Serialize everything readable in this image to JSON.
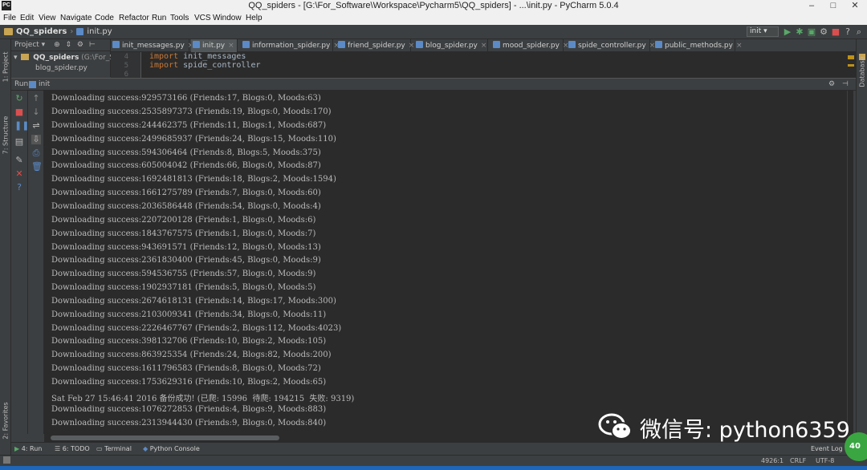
{
  "window": {
    "title": "QQ_spiders - [G:\\For_Software\\Workspace\\Pycharm5\\QQ_spiders] - ...\\init.py - PyCharm 5.0.4",
    "app_icon": "PC",
    "minimize": "–",
    "maximize": "□",
    "close": "✕"
  },
  "menu": [
    "File",
    "Edit",
    "View",
    "Navigate",
    "Code",
    "Refactor",
    "Run",
    "Tools",
    "VCS",
    "Window",
    "Help"
  ],
  "breadcrumb": {
    "project": "QQ_spiders",
    "file": "init.py"
  },
  "run_config": "init",
  "project_panel": {
    "dropdown": "Project",
    "root": "QQ_spiders",
    "root_path": "(G:\\For_So",
    "child": "blog_spider.py"
  },
  "tabs": [
    {
      "label": "init_messages.py",
      "active": false
    },
    {
      "label": "init.py",
      "active": true
    },
    {
      "label": "information_spider.py",
      "active": false
    },
    {
      "label": "friend_spider.py",
      "active": false
    },
    {
      "label": "blog_spider.py",
      "active": false
    },
    {
      "label": "mood_spider.py",
      "active": false
    },
    {
      "label": "spide_controller.py",
      "active": false
    },
    {
      "label": "public_methods.py",
      "active": false
    }
  ],
  "editor": {
    "lines": [
      {
        "num": "4",
        "kw": "import",
        "name": "init_messages"
      },
      {
        "num": "5",
        "kw": "import",
        "name": "spide_controller"
      },
      {
        "num": "6",
        "kw": "",
        "name": ""
      }
    ]
  },
  "run_panel": {
    "label": "Run",
    "config": "init"
  },
  "left_tool_windows": {
    "project": "1: Project",
    "structure": "7: Structure",
    "favorites": "2: Favorites"
  },
  "right_tool_windows": {
    "database": "Database"
  },
  "console": [
    "Downloading success:929573166 (Friends:17, Blogs:0, Moods:63)",
    "Downloading success:2535897373 (Friends:19, Blogs:0, Moods:170)",
    "Downloading success:244462375 (Friends:11, Blogs:1, Moods:687)",
    "Downloading success:2499685937 (Friends:24, Blogs:15, Moods:110)",
    "Downloading success:594306464 (Friends:8, Blogs:5, Moods:375)",
    "Downloading success:605004042 (Friends:66, Blogs:0, Moods:87)",
    "Downloading success:1692481813 (Friends:18, Blogs:2, Moods:1594)",
    "Downloading success:1661275789 (Friends:7, Blogs:0, Moods:60)",
    "Downloading success:2036586448 (Friends:54, Blogs:0, Moods:4)",
    "Downloading success:2207200128 (Friends:1, Blogs:0, Moods:6)",
    "Downloading success:1843767575 (Friends:1, Blogs:0, Moods:7)",
    "Downloading success:943691571 (Friends:12, Blogs:0, Moods:13)",
    "Downloading success:2361830400 (Friends:45, Blogs:0, Moods:9)",
    "Downloading success:594536755 (Friends:57, Blogs:0, Moods:9)",
    "Downloading success:1902937181 (Friends:5, Blogs:0, Moods:5)",
    "Downloading success:2674618131 (Friends:14, Blogs:17, Moods:300)",
    "Downloading success:2103009341 (Friends:34, Blogs:0, Moods:11)",
    "Downloading success:2226467767 (Friends:2, Blogs:112, Moods:4023)",
    "Downloading success:398132706 (Friends:10, Blogs:2, Moods:105)",
    "Downloading success:863925354 (Friends:24, Blogs:82, Moods:200)",
    "Downloading success:1611796583 (Friends:8, Blogs:0, Moods:72)",
    "Downloading success:1753629316 (Friends:10, Blogs:2, Moods:65)",
    "Sat Feb 27 15:46:41 2016 备份成功! (已爬: 15996  待爬: 194215  失败: 9319)",
    "Downloading success:1076272853 (Friends:4, Blogs:9, Moods:883)",
    "Downloading success:2313944430 (Friends:9, Blogs:0, Moods:840)"
  ],
  "bottom_tools": {
    "run": "4: Run",
    "todo": "6: TODO",
    "terminal": "Terminal",
    "python_console": "Python Console",
    "event_log": "Event Log"
  },
  "status": {
    "position": "4926:1",
    "line_sep": "CRLF",
    "encoding": "UTF-8"
  },
  "watermark": {
    "text": "微信号: python6359"
  },
  "avatar_badge": "40",
  "colors": {
    "console_bg": "#2b2b2b",
    "panel_bg": "#3c3f41",
    "keyword": "#cc7832",
    "run_green": "#59a869",
    "taskbar": "#1f66b8"
  }
}
